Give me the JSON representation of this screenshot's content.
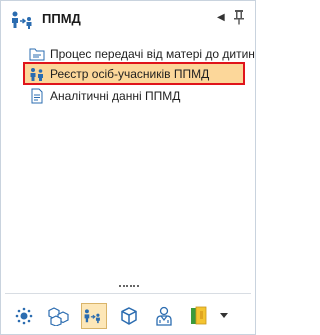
{
  "header": {
    "title": "ППМД",
    "collapse_icon": "triangle-left-icon",
    "pin_icon": "pin-icon"
  },
  "tree": {
    "items": [
      {
        "label": "Процес передачі від матері до дитини",
        "icon": "folder-icon"
      },
      {
        "label": "Реєстр осіб-учасників ППМД",
        "icon": "people-icon",
        "selected": true
      },
      {
        "label": "Аналітичні данні ППМД",
        "icon": "document-icon"
      }
    ]
  },
  "toolbar": {
    "buttons": [
      {
        "icon": "sun-gear-icon"
      },
      {
        "icon": "boxes-icon"
      },
      {
        "icon": "family-icon",
        "active": true
      },
      {
        "icon": "cube-icon"
      },
      {
        "icon": "doctor-icon"
      },
      {
        "icon": "folders-icon"
      },
      {
        "icon": "dropdown-icon"
      }
    ]
  },
  "colors": {
    "selected_bg": "#fcd79a",
    "selected_outline": "#e0141b",
    "accent_blue": "#2b6cb0"
  }
}
